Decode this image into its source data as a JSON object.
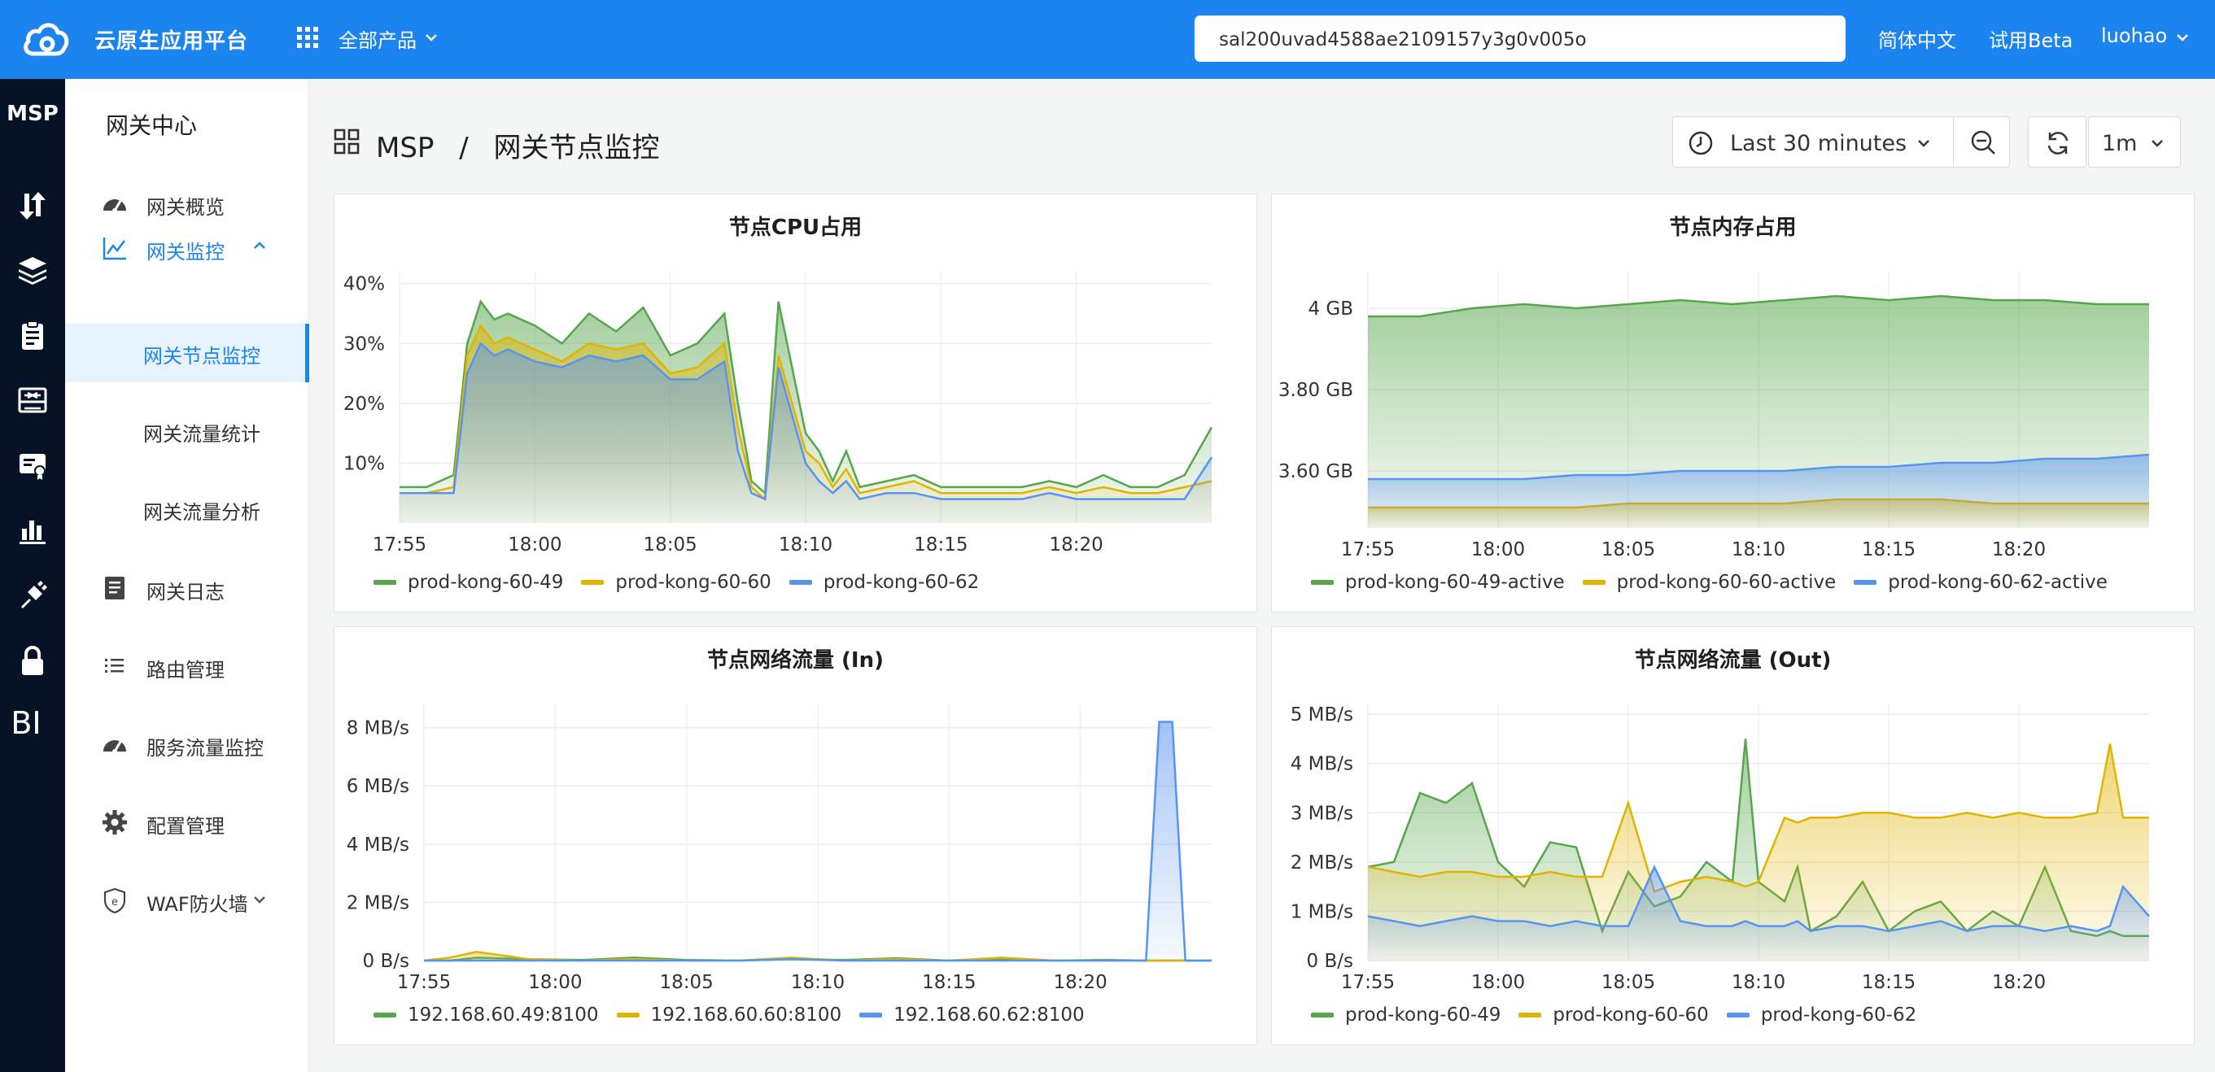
{
  "topbar": {
    "brand": "云原生应用平台",
    "products_label": "全部产品",
    "search_value": "sal200uvad4588ae2109157y3g0v005o",
    "language": "简体中文",
    "beta": "试用Beta",
    "user": "luohao"
  },
  "rail": {
    "title": "MSP",
    "bi_label": "BI"
  },
  "side": {
    "title": "网关中心",
    "items": [
      {
        "label": "网关概览",
        "icon": "dashboard-icon"
      },
      {
        "label": "网关监控",
        "icon": "line-chart-icon",
        "expanded": true
      },
      {
        "label": "网关节点监控",
        "sub": true,
        "selected": true
      },
      {
        "label": "网关流量统计",
        "sub": true
      },
      {
        "label": "网关流量分析",
        "sub": true
      },
      {
        "label": "网关日志",
        "icon": "log-icon"
      },
      {
        "label": "路由管理",
        "icon": "list-icon"
      },
      {
        "label": "服务流量监控",
        "icon": "dashboard-icon"
      },
      {
        "label": "配置管理",
        "icon": "gear-icon"
      },
      {
        "label": "WAF防火墙",
        "icon": "shield-icon"
      }
    ]
  },
  "header": {
    "crumb_root": "MSP",
    "crumb_sep": "/",
    "crumb_page": "网关节点监控",
    "time_range": "Last 30 minutes",
    "interval": "1m"
  },
  "colors": {
    "green": "#56a64b",
    "yellow": "#e0b400",
    "blue": "#5794f2",
    "accent": "#1b84f0"
  },
  "chart_data": [
    {
      "type": "area",
      "title": "节点CPU占用",
      "x_ticks": [
        "17:55",
        "18:00",
        "18:05",
        "18:10",
        "18:15",
        "18:20"
      ],
      "y_ticks": [
        "10%",
        "20%",
        "30%",
        "40%"
      ],
      "ylim": [
        0,
        42
      ],
      "legend": [
        "prod-kong-60-49",
        "prod-kong-60-60",
        "prod-kong-60-62"
      ],
      "x_minutes": [
        0,
        1,
        2,
        2.5,
        3,
        3.5,
        4,
        5,
        6,
        7,
        8,
        9,
        10,
        11,
        12,
        12.5,
        13,
        13.5,
        14,
        15,
        15.5,
        16,
        16.5,
        17,
        18,
        19,
        20,
        21,
        22,
        23,
        24,
        25,
        26,
        27,
        28,
        29,
        30
      ],
      "series": [
        {
          "name": "prod-kong-60-49",
          "values": [
            6,
            6,
            8,
            30,
            37,
            34,
            35,
            33,
            30,
            35,
            32,
            36,
            28,
            30,
            35,
            20,
            7,
            5,
            37,
            15,
            12,
            7,
            12,
            6,
            7,
            8,
            6,
            6,
            6,
            6,
            7,
            6,
            8,
            6,
            6,
            8,
            16
          ]
        },
        {
          "name": "prod-kong-60-60",
          "values": [
            5,
            5,
            6,
            28,
            33,
            30,
            31,
            29,
            27,
            30,
            29,
            30,
            25,
            26,
            30,
            16,
            6,
            4,
            28,
            12,
            10,
            6,
            9,
            5,
            6,
            7,
            5,
            5,
            5,
            5,
            6,
            5,
            6,
            5,
            5,
            6,
            7
          ]
        },
        {
          "name": "prod-kong-60-62",
          "values": [
            5,
            5,
            5,
            25,
            30,
            28,
            29,
            27,
            26,
            28,
            27,
            28,
            24,
            24,
            27,
            12,
            5,
            4,
            26,
            10,
            7,
            5,
            7,
            4,
            5,
            5,
            4,
            4,
            4,
            4,
            5,
            4,
            4,
            4,
            4,
            4,
            11
          ]
        }
      ]
    },
    {
      "type": "area",
      "title": "节点内存占用",
      "x_ticks": [
        "17:55",
        "18:00",
        "18:05",
        "18:10",
        "18:15",
        "18:20"
      ],
      "y_ticks": [
        "3.60 GB",
        "3.80 GB",
        "4 GB"
      ],
      "ylim": [
        3.46,
        4.09
      ],
      "legend": [
        "prod-kong-60-49-active",
        "prod-kong-60-60-active",
        "prod-kong-60-62-active"
      ],
      "x_minutes": [
        0,
        2,
        4,
        6,
        8,
        10,
        12,
        14,
        16,
        18,
        20,
        22,
        24,
        26,
        28,
        30
      ],
      "series": [
        {
          "name": "prod-kong-60-49-active",
          "values": [
            3.98,
            3.98,
            4.0,
            4.01,
            4.0,
            4.01,
            4.02,
            4.01,
            4.02,
            4.03,
            4.02,
            4.03,
            4.02,
            4.02,
            4.01,
            4.01
          ]
        },
        {
          "name": "prod-kong-60-60-active",
          "values": [
            3.51,
            3.51,
            3.51,
            3.51,
            3.51,
            3.52,
            3.52,
            3.52,
            3.52,
            3.53,
            3.53,
            3.53,
            3.52,
            3.52,
            3.52,
            3.52
          ]
        },
        {
          "name": "prod-kong-60-62-active",
          "values": [
            3.58,
            3.58,
            3.58,
            3.58,
            3.59,
            3.59,
            3.6,
            3.6,
            3.6,
            3.61,
            3.61,
            3.62,
            3.62,
            3.63,
            3.63,
            3.64
          ]
        }
      ]
    },
    {
      "type": "area",
      "title": "节点网络流量 (In)",
      "x_ticks": [
        "17:55",
        "18:00",
        "18:05",
        "18:10",
        "18:15",
        "18:20"
      ],
      "y_ticks": [
        "0 B/s",
        "2 MB/s",
        "4 MB/s",
        "6 MB/s",
        "8 MB/s"
      ],
      "ylim": [
        0,
        8.8
      ],
      "legend": [
        "192.168.60.49:8100",
        "192.168.60.60:8100",
        "192.168.60.62:8100"
      ],
      "x_minutes": [
        0,
        1,
        2,
        4,
        6,
        8,
        10,
        12,
        14,
        16,
        18,
        20,
        22,
        24,
        26,
        27.5,
        28,
        28.5,
        29,
        29.5,
        30
      ],
      "series": [
        {
          "name": "192.168.60.49:8100",
          "values": [
            0,
            0,
            0.1,
            0.05,
            0.02,
            0.1,
            0.02,
            0,
            0.05,
            0.02,
            0.08,
            0,
            0.05,
            0,
            0.02,
            0,
            0,
            0,
            0,
            0,
            0
          ]
        },
        {
          "name": "192.168.60.60:8100",
          "values": [
            0,
            0.1,
            0.3,
            0.05,
            0,
            0.05,
            0,
            0,
            0.1,
            0,
            0.05,
            0,
            0.1,
            0,
            0,
            0,
            0,
            0,
            0,
            0,
            0
          ]
        },
        {
          "name": "192.168.60.62:8100",
          "values": [
            0,
            0,
            0,
            0,
            0,
            0,
            0,
            0,
            0.05,
            0,
            0,
            0,
            0,
            0,
            0,
            0,
            8.2,
            8.2,
            0,
            0,
            0
          ]
        }
      ]
    },
    {
      "type": "area",
      "title": "节点网络流量 (Out)",
      "x_ticks": [
        "17:55",
        "18:00",
        "18:05",
        "18:10",
        "18:15",
        "18:20"
      ],
      "y_ticks": [
        "0 B/s",
        "1 MB/s",
        "2 MB/s",
        "3 MB/s",
        "4 MB/s",
        "5 MB/s"
      ],
      "ylim": [
        0,
        5.2
      ],
      "legend": [
        "prod-kong-60-49",
        "prod-kong-60-60",
        "prod-kong-60-62"
      ],
      "x_minutes": [
        0,
        1,
        2,
        3,
        4,
        5,
        6,
        7,
        8,
        9,
        10,
        11,
        12,
        13,
        14,
        14.5,
        15,
        16,
        16.5,
        17,
        18,
        19,
        20,
        21,
        22,
        23,
        24,
        25,
        26,
        27,
        28,
        28.5,
        29,
        30
      ],
      "series": [
        {
          "name": "prod-kong-60-49",
          "values": [
            1.9,
            2.0,
            3.4,
            3.2,
            3.6,
            2.0,
            1.5,
            2.4,
            2.3,
            0.6,
            1.8,
            1.1,
            1.3,
            2.0,
            1.6,
            4.5,
            1.6,
            1.2,
            1.9,
            0.6,
            0.9,
            1.6,
            0.6,
            1.0,
            1.2,
            0.6,
            1.0,
            0.7,
            1.9,
            0.6,
            0.5,
            0.6,
            0.5,
            0.5
          ]
        },
        {
          "name": "prod-kong-60-60",
          "values": [
            1.9,
            1.8,
            1.7,
            1.8,
            1.8,
            1.7,
            1.7,
            1.8,
            1.7,
            1.7,
            3.2,
            1.4,
            1.6,
            1.7,
            1.6,
            1.5,
            1.6,
            2.9,
            2.8,
            2.9,
            2.9,
            3.0,
            3.0,
            2.9,
            2.9,
            3.0,
            2.9,
            3.0,
            2.9,
            2.9,
            3.0,
            4.4,
            2.9,
            2.9
          ]
        },
        {
          "name": "prod-kong-60-62",
          "values": [
            0.9,
            0.8,
            0.7,
            0.8,
            0.9,
            0.8,
            0.8,
            0.7,
            0.8,
            0.7,
            0.7,
            1.9,
            0.8,
            0.7,
            0.7,
            0.8,
            0.7,
            0.7,
            0.8,
            0.6,
            0.7,
            0.7,
            0.6,
            0.7,
            0.8,
            0.6,
            0.7,
            0.7,
            0.6,
            0.7,
            0.6,
            0.7,
            1.5,
            0.9
          ]
        }
      ]
    }
  ]
}
